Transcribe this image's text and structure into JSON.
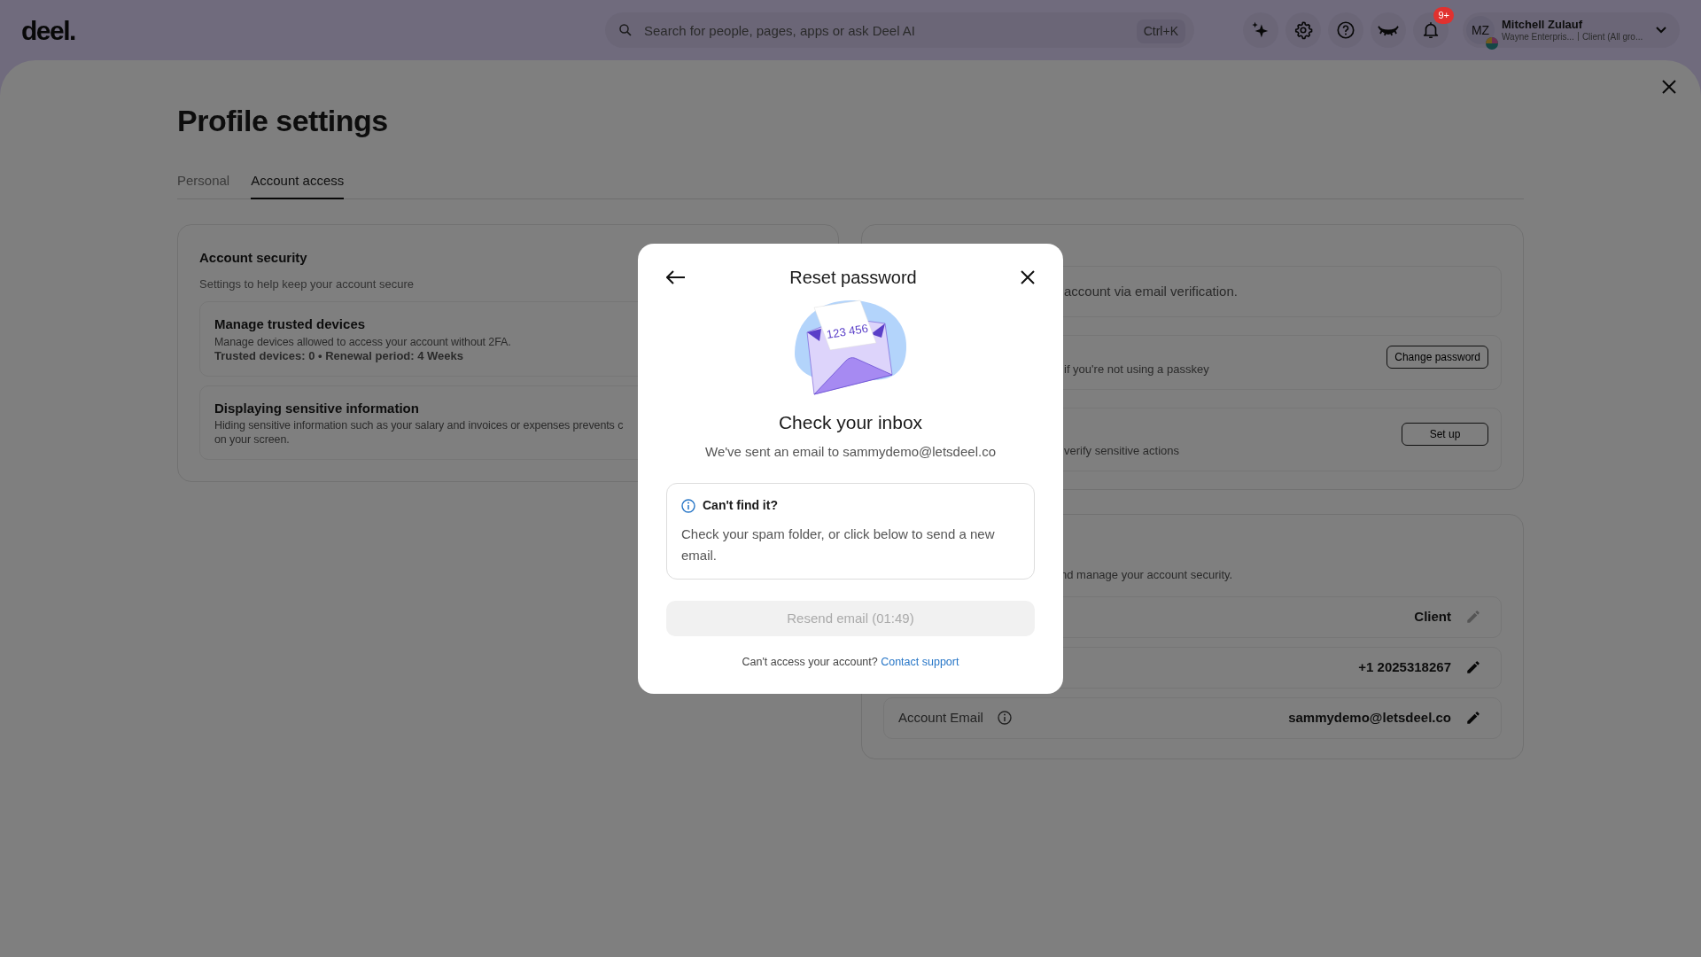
{
  "topbar": {
    "logo": "deel.",
    "search": {
      "placeholder": "Search for people, pages, apps or ask Deel AI",
      "shortcut": "Ctrl+K"
    },
    "notifications_badge": "9+",
    "user": {
      "initials": "MZ",
      "name": "Mitchell Zulauf",
      "org": "Wayne Enterpris...",
      "role": "Client (All gro..."
    }
  },
  "page": {
    "title": "Profile settings",
    "tabs": [
      {
        "label": "Personal",
        "selected": false
      },
      {
        "label": "Account access",
        "selected": true
      }
    ]
  },
  "account_security": {
    "title": "Account security",
    "subtitle": "Settings to help keep your account secure",
    "items": [
      {
        "title": "Manage trusted devices",
        "description": [
          "Manage devices allowed to access your account without 2FA."
        ],
        "detail": "Trusted devices: 0 • Renewal period: 4 Weeks"
      },
      {
        "title": "Displaying sensitive information",
        "description": [
          "Hiding sensitive information such as your salary and invoices or expenses prevents c",
          "on your screen."
        ]
      }
    ]
  },
  "login_card": {
    "rows": [
      {
        "kind": "note",
        "text": "account via email verification."
      },
      {
        "kind": "action",
        "text": "if you're not using a passkey",
        "button": "Change password"
      },
      {
        "kind": "action",
        "text": "verify sensitive actions",
        "button": "Set up"
      }
    ]
  },
  "roles_card": {
    "subtitle": "nd manage your account security.",
    "rows": [
      {
        "value": "Client",
        "disabled": true
      },
      {
        "value": "+1 2025318267",
        "disabled": false
      },
      {
        "label": "Account Email",
        "value": "sammydemo@letsdeel.co",
        "disabled": false
      }
    ]
  },
  "modal": {
    "title": "Reset password",
    "illustration_code": "123 456",
    "heading": "Check your inbox",
    "message": "We've sent an email to sammydemo@letsdeel.co",
    "callout": {
      "title": "Can't find it?",
      "text": "Check your spam folder, or click below to send a new email."
    },
    "resend_button": {
      "label": "Resend email (01:49)",
      "disabled": true
    },
    "footer": {
      "text": "Can't access your account?",
      "link": "Contact support"
    }
  }
}
